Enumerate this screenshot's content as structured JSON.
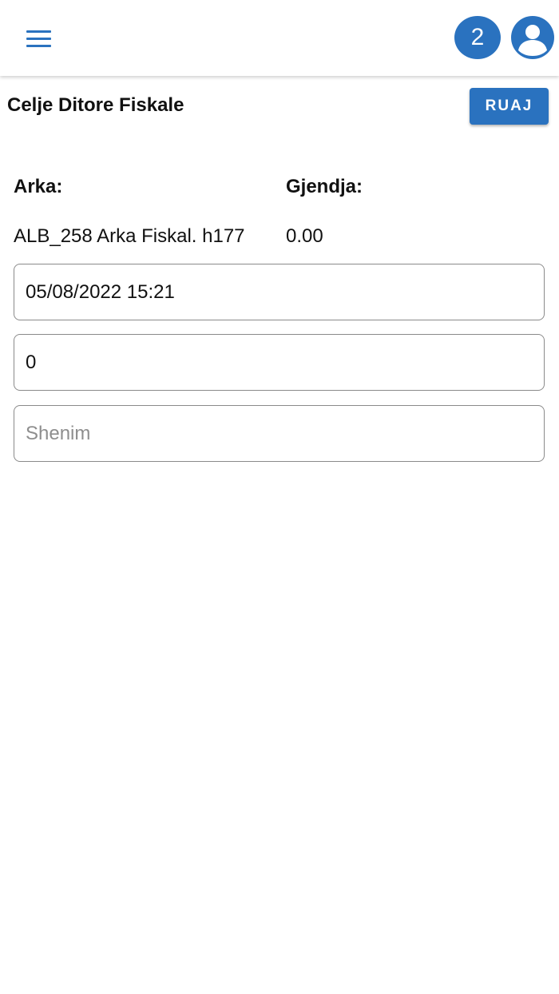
{
  "appbar": {
    "menu_icon": "hamburger-menu-icon",
    "notification_count": "2",
    "avatar_icon": "user-avatar-icon"
  },
  "page": {
    "title": "Celje Ditore Fiskale",
    "save_label": "RUAJ"
  },
  "details": {
    "arka_label": "Arka:",
    "arka_value": "ALB_258 Arka Fiskal. h177",
    "gjendja_label": "Gjendja:",
    "gjendja_value": "0.00"
  },
  "form": {
    "datetime_value": "05/08/2022 15:21",
    "amount_value": "0",
    "note_value": "",
    "note_placeholder": "Shenim"
  },
  "colors": {
    "accent": "#2a72bf",
    "border": "#8a8a8a",
    "placeholder": "#8e8e8e"
  }
}
